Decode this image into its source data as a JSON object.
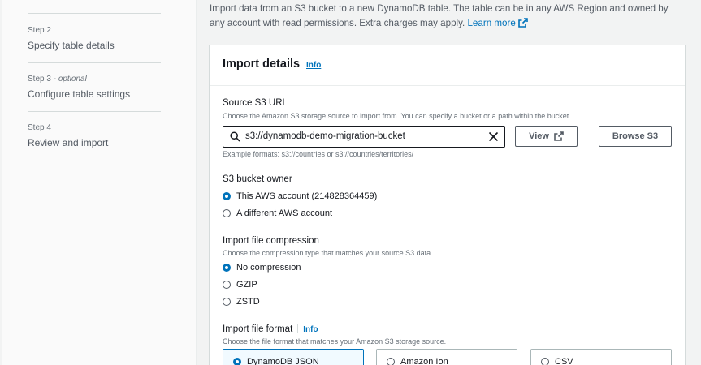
{
  "nav": {
    "steps": [
      {
        "num": "Step 2",
        "optional": "",
        "label": "Specify table details"
      },
      {
        "num": "Step 3 - ",
        "optional": "optional",
        "label": "Configure table settings"
      },
      {
        "num": "Step 4",
        "optional": "",
        "label": "Review and import"
      }
    ]
  },
  "intro": {
    "text": "Import data from an S3 bucket to a new DynamoDB table. The table can be in any AWS Region and owned by any account with read permissions. Extra charges may apply.",
    "learn_more": "Learn more"
  },
  "panel": {
    "title": "Import details",
    "info": "Info"
  },
  "source": {
    "label": "Source S3 URL",
    "description": "Choose the Amazon S3 storage source to import from. You can specify a bucket or a path within the bucket.",
    "value": "s3://dynamodb-demo-migration-bucket",
    "hint": "Example formats: s3://countries or s3://countries/territories/",
    "view_button": "View",
    "browse_button": "Browse S3"
  },
  "owner": {
    "label": "S3 bucket owner",
    "options": [
      "This AWS account (214828364459)",
      "A different AWS account"
    ]
  },
  "compression": {
    "label": "Import file compression",
    "description": "Choose the compression type that matches your source S3 data.",
    "options": [
      "No compression",
      "GZIP",
      "ZSTD"
    ]
  },
  "format": {
    "label": "Import file format",
    "info": "Info",
    "description": "Choose the file format that matches your Amazon S3 storage source.",
    "options": [
      "DynamoDB JSON",
      "Amazon Ion",
      "CSV"
    ]
  },
  "colors": {
    "accent": "#0073bb",
    "text": "#16191f",
    "secondary_text": "#545b64",
    "border": "#d5dbdb",
    "page_bg": "#f2f3f3"
  }
}
